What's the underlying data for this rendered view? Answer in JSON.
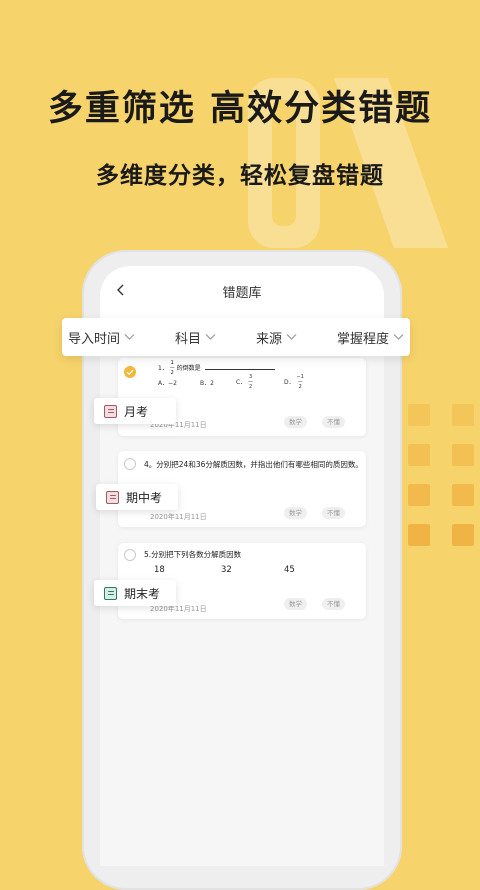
{
  "headline": "多重筛选 高效分类错题",
  "subline": "多维度分类，轻松复盘错题",
  "colors": {
    "background": "#F7D36B",
    "accent": "#F3B73A",
    "badge_red": "#9C5A63",
    "badge_green": "#2F7A5E"
  },
  "nav": {
    "back_icon": "chevron-left-icon",
    "title": "错题库"
  },
  "filters": [
    {
      "label": "导入时间"
    },
    {
      "label": "科目"
    },
    {
      "label": "来源"
    },
    {
      "label": "掌握程度"
    }
  ],
  "cards": [
    {
      "checked": true,
      "question_lead": "1．",
      "question_tail": "的倒数是",
      "options": [
        "A．−2",
        "B．2",
        "C．",
        "D．"
      ],
      "date": "2020年11月11日",
      "tags": [
        "数学",
        "不懂"
      ]
    },
    {
      "checked": false,
      "question": "4。分别把24和36分解质因数，并指出他们有哪些相同的质因数。",
      "date": "2020年11月11日",
      "tags": [
        "数学",
        "不懂"
      ]
    },
    {
      "checked": false,
      "question": "5.分别把下列各数分解质因数",
      "numbers": [
        "18",
        "32",
        "45"
      ],
      "date": "2020年11月11日",
      "tags": [
        "数学",
        "不懂"
      ]
    }
  ],
  "badges": [
    {
      "label": "月考",
      "icon": "document-icon"
    },
    {
      "label": "期中考",
      "icon": "document-icon"
    },
    {
      "label": "期末考",
      "icon": "document-icon"
    }
  ]
}
